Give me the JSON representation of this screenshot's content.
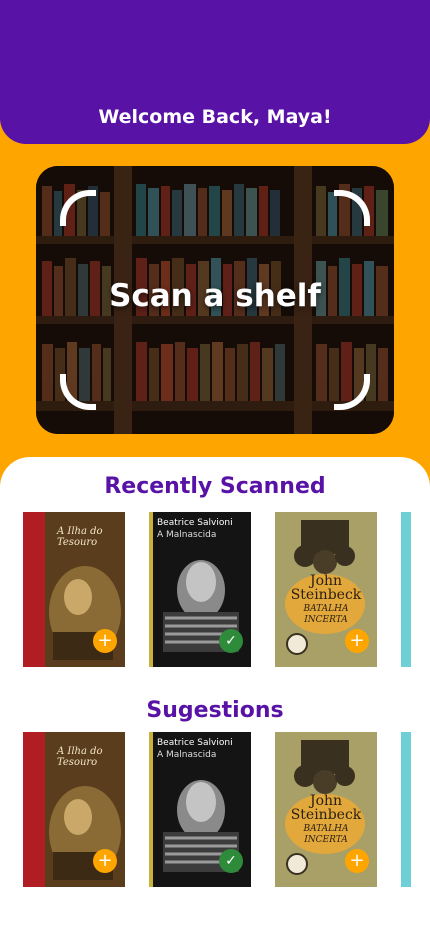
{
  "header": {
    "welcome": "Welcome Back, Maya!"
  },
  "scan": {
    "label": "Scan a shelf"
  },
  "recent": {
    "title": "Recently Scanned",
    "books": [
      {
        "title": "A Ilha do Tesouro",
        "status": "add"
      },
      {
        "author": "Beatrice Salvioni",
        "title": "A Malnascida",
        "status": "added"
      },
      {
        "author": "John Steinbeck",
        "title": "BATALHA INCERTA",
        "status": "add"
      }
    ]
  },
  "suggestions": {
    "title": "Sugestions",
    "books": [
      {
        "title": "A Ilha do Tesouro",
        "status": "add"
      },
      {
        "author": "Beatrice Salvioni",
        "title": "A Malnascida",
        "status": "added"
      },
      {
        "author": "John Steinbeck",
        "title": "BATALHA INCERTA",
        "status": "add"
      }
    ]
  },
  "icons": {
    "add": "plus-icon",
    "added": "check-icon"
  },
  "colors": {
    "primary": "#5812A6",
    "accent": "#FFA500",
    "added": "#2E8B3A"
  }
}
